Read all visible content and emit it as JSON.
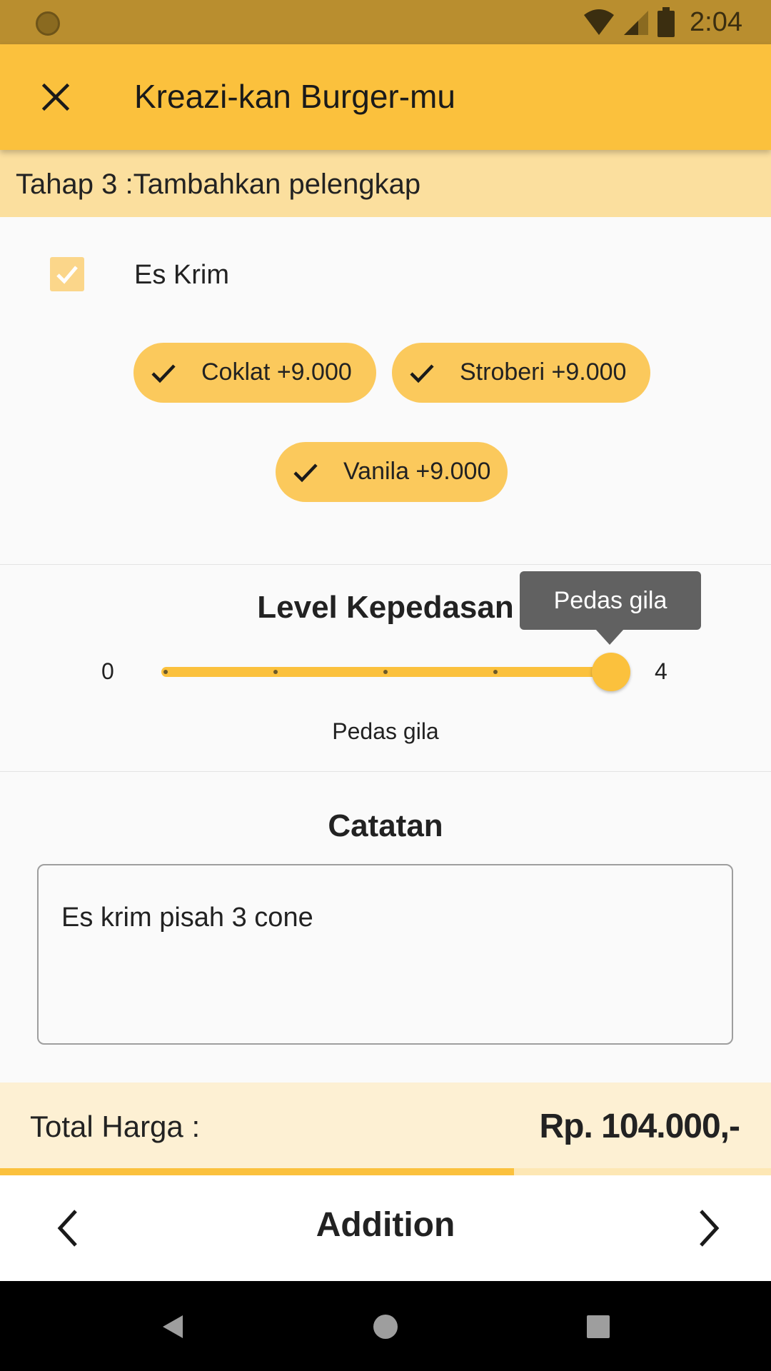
{
  "status_bar": {
    "time": "2:04",
    "icons": [
      "wifi-icon",
      "signal-icon",
      "battery-icon"
    ]
  },
  "app_bar": {
    "title": "Kreazi-kan Burger-mu",
    "close_icon": "close-icon"
  },
  "step": {
    "label": "Tahap 3 :Tambahkan pelengkap"
  },
  "option": {
    "label": "Es Krim",
    "checked": true
  },
  "chips": [
    {
      "label": "Coklat +9.000",
      "selected": true
    },
    {
      "label": "Stroberi +9.000",
      "selected": true
    },
    {
      "label": "Vanila +9.000",
      "selected": true
    }
  ],
  "spicy": {
    "title": "Level Kepedasan",
    "min_label": "0",
    "max_label": "4",
    "value": 4,
    "value_label": "Pedas gila",
    "tooltip": "Pedas gila"
  },
  "notes": {
    "title": "Catatan",
    "value": "Es krim pisah 3 cone"
  },
  "total": {
    "label": "Total Harga :",
    "value": "Rp. 104.000,-"
  },
  "progress": {
    "fraction": 0.667
  },
  "bottom_nav": {
    "title": "Addition",
    "prev_icon": "chevron-left-icon",
    "next_icon": "chevron-right-icon"
  },
  "colors": {
    "accent": "#fbc13d",
    "status_bar": "#b98e2f",
    "step_bar": "#fbdf9e",
    "total_bar": "#fdf0d3",
    "chip": "#fbc95c"
  }
}
